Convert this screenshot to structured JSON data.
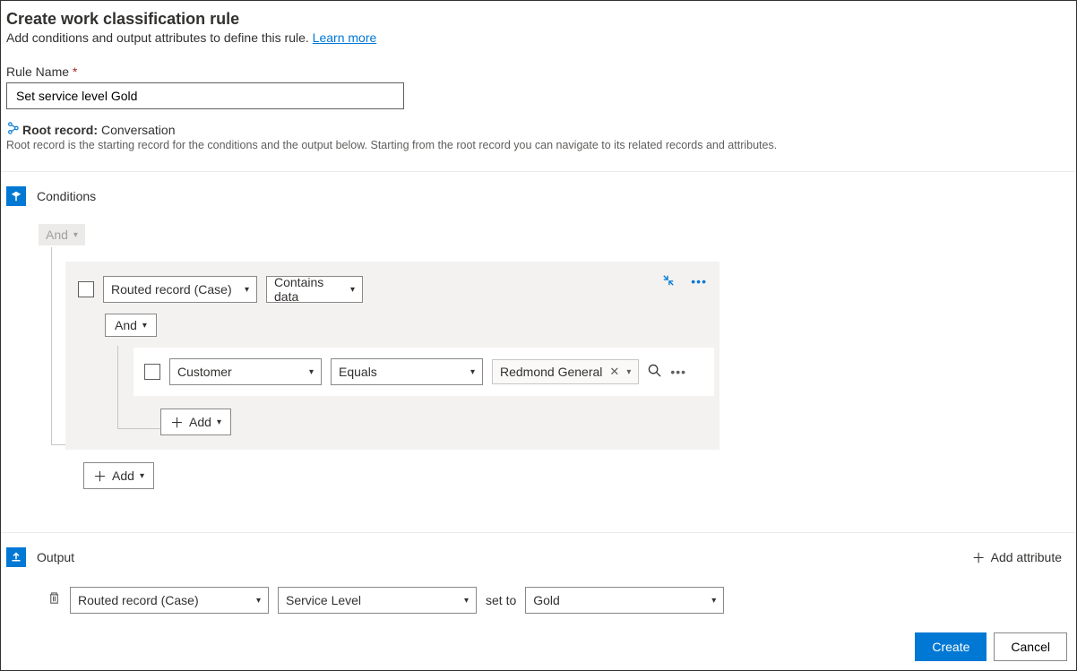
{
  "header": {
    "title": "Create work classification rule",
    "subtitle": "Add conditions and output attributes to define this rule. ",
    "learn_more": "Learn more"
  },
  "rule_name": {
    "label": "Rule Name",
    "value": "Set service level Gold"
  },
  "root_record": {
    "label": "Root record:",
    "value": "Conversation",
    "desc": "Root record is the starting record for the conditions and the output below. Starting from the root record you can navigate to its related records and attributes."
  },
  "conditions": {
    "title": "Conditions",
    "root_operator": "And",
    "group": {
      "field": "Routed record (Case)",
      "operator": "Contains data",
      "inner_operator": "And",
      "inner": {
        "field": "Customer",
        "op": "Equals",
        "value": "Redmond General"
      },
      "add_inner": "Add"
    },
    "add_outer": "Add"
  },
  "output": {
    "title": "Output",
    "add_attribute": "Add attribute",
    "row": {
      "field": "Routed record (Case)",
      "attribute": "Service Level",
      "set_to": "set to",
      "value": "Gold"
    }
  },
  "footer": {
    "create": "Create",
    "cancel": "Cancel"
  }
}
